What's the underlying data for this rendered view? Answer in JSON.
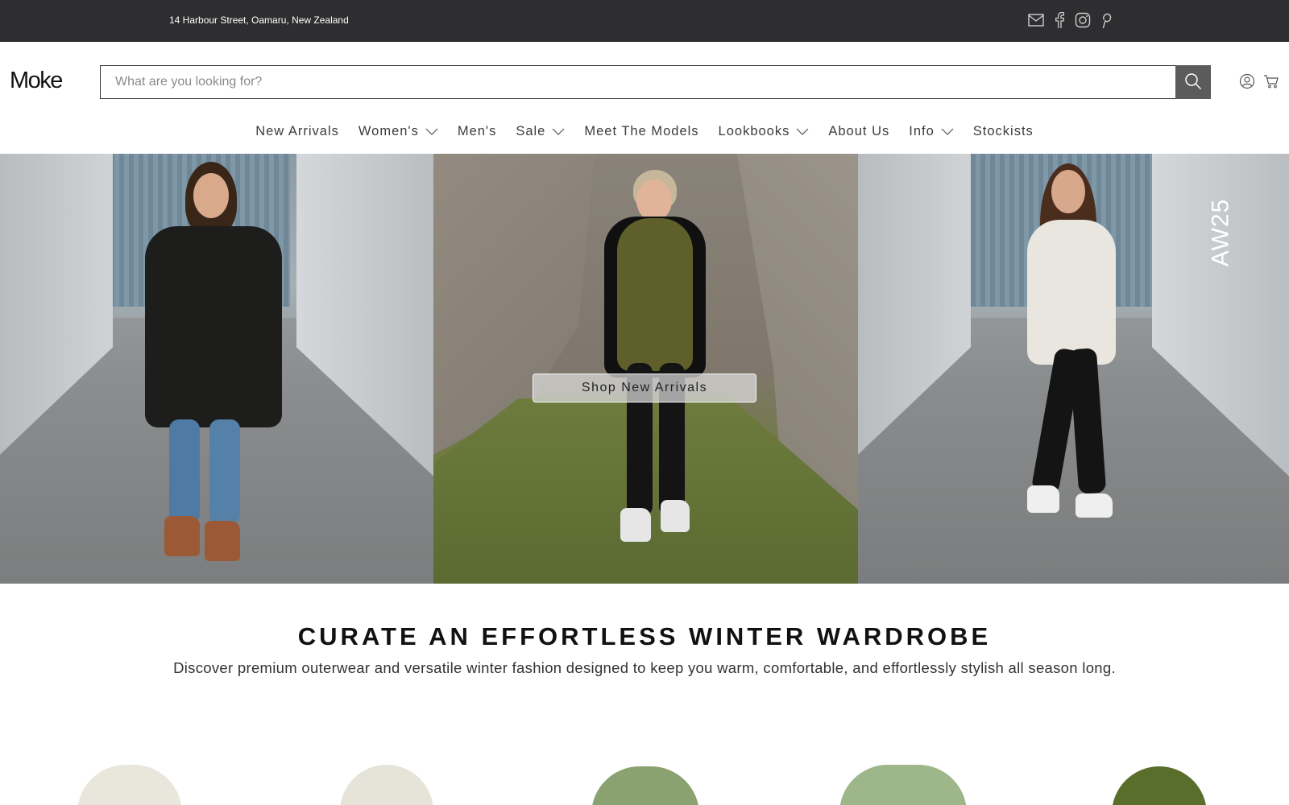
{
  "topbar": {
    "address": "14 Harbour Street, Oamaru, New Zealand",
    "social_icons": [
      "mail-icon",
      "facebook-icon",
      "instagram-icon",
      "pinterest-icon"
    ]
  },
  "header": {
    "logo": "Moke",
    "search_placeholder": "What are you looking for?",
    "icons": [
      "search-icon",
      "account-icon",
      "cart-icon"
    ]
  },
  "nav": {
    "items": [
      {
        "label": "New Arrivals",
        "dropdown": false
      },
      {
        "label": "Women's",
        "dropdown": true
      },
      {
        "label": "Men's",
        "dropdown": false
      },
      {
        "label": "Sale",
        "dropdown": true
      },
      {
        "label": "Meet The Models",
        "dropdown": false
      },
      {
        "label": "Lookbooks",
        "dropdown": true
      },
      {
        "label": "About Us",
        "dropdown": false
      },
      {
        "label": "Info",
        "dropdown": true
      },
      {
        "label": "Stockists",
        "dropdown": false
      }
    ]
  },
  "hero": {
    "cta_label": "Shop New Arrivals",
    "side_label": "AW25"
  },
  "section": {
    "headline": "CURATE AN EFFORTLESS WINTER WARDROBE",
    "subline": "Discover premium outerwear and versatile winter fashion designed to keep you warm, comfortable, and effortlessly stylish all season long."
  },
  "colors": {
    "topbar_bg": "#2e2d2f",
    "search_button_bg": "#5b5b5c",
    "text_dark": "#111111"
  }
}
